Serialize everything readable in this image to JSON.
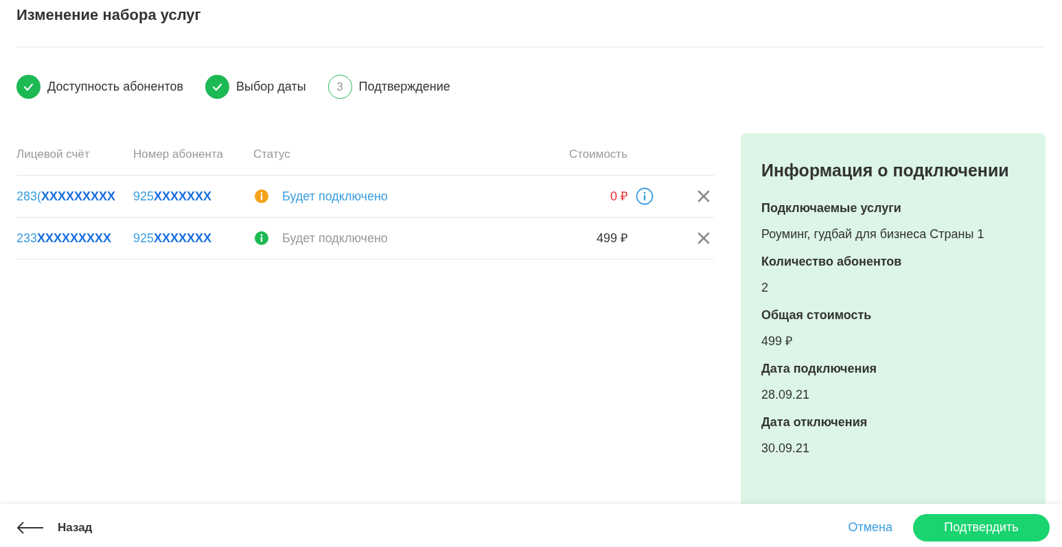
{
  "title": "Изменение набора услуг",
  "steps": [
    {
      "label": "Доступность абонентов",
      "done": true
    },
    {
      "label": "Выбор даты",
      "done": true
    },
    {
      "number": "3",
      "label": "Подтверждение",
      "done": false
    }
  ],
  "table": {
    "columns": [
      "Лицевой счёт",
      "Номер абонента",
      "Статус",
      "Стоимость"
    ],
    "rows": [
      {
        "account": "283(**XXXXXXXXX**",
        "phone": "925**XXXXXXX**",
        "kind": "warning",
        "status": "Будет подключено",
        "cost": "0 ₽",
        "info": true
      },
      {
        "account": "233**XXXXXXXXX**",
        "phone": "925**XXXXXXX**",
        "kind": "ok",
        "status": "Будет подключено",
        "cost": "499 ₽",
        "info": false
      }
    ]
  },
  "panel": {
    "title": "Информация о подключении",
    "fields": [
      {
        "label": "Подключаемые услуги",
        "value": "Роуминг, гудбай для бизнеса Страны 1"
      },
      {
        "label": "Количество абонентов",
        "value": "2"
      },
      {
        "label": "Общая стоимость",
        "value": "499 ₽"
      },
      {
        "label": "Дата подключения",
        "value": "28.09.21"
      },
      {
        "label": "Дата отключения",
        "value": "30.09.21"
      }
    ]
  },
  "footer": {
    "back": "Назад",
    "cancel": "Отмена",
    "confirm": "Подтвердить"
  }
}
